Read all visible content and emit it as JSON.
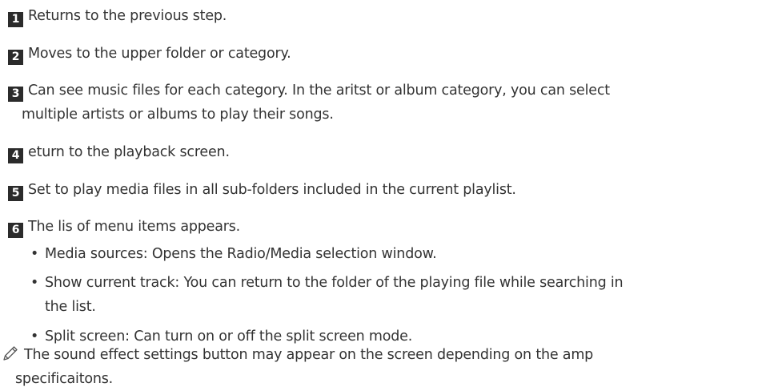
{
  "items": [
    {
      "number": "1",
      "text": "Returns to the previous step."
    },
    {
      "number": "2",
      "text": "Moves to the upper folder or category."
    },
    {
      "number": "3",
      "text": "Can see music files for each category. In the aritst or album category, you can select",
      "text_cont": "multiple artists or albums to play their songs."
    },
    {
      "number": "4",
      "text": "eturn to the playback screen."
    },
    {
      "number": "5",
      "text": "Set to play media files in all sub-folders included in the current playlist."
    },
    {
      "number": "6",
      "text": "The lis of menu items appears."
    }
  ],
  "bullets": [
    {
      "marker": "•",
      "text": "Media sources: Opens the Radio/Media selection window."
    },
    {
      "marker": "•",
      "text": "Show current track: You can return to the folder of the playing file while searching in",
      "text_cont": "the list."
    },
    {
      "marker": "•",
      "text": "Split screen: Can turn on or off the split screen mode."
    }
  ],
  "note": {
    "icon": "pencil-icon",
    "text": "The sound effect settings button may appear on the screen depending on the amp",
    "text_cont": "specificaitons."
  }
}
